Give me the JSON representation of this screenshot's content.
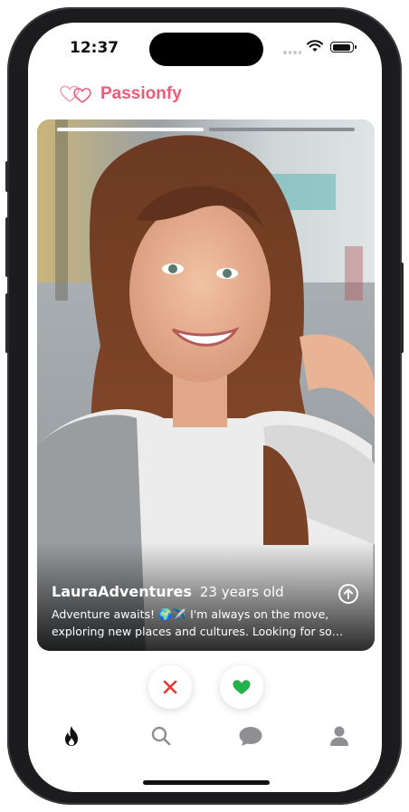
{
  "status_bar": {
    "time": "12:37"
  },
  "app": {
    "brand_name": "Passionfy",
    "brand_color": "#ef5a78"
  },
  "profile_card": {
    "photo_count": 2,
    "active_photo": 1,
    "username": "LauraAdventures",
    "age_label": "23 years old",
    "bio_line_1": "Adventure awaits! 🌍✈️ I'm always on the move,",
    "bio_line_2": "exploring new places and cultures. Looking for someo..."
  },
  "actions": {
    "dislike_icon": "close-icon",
    "dislike_color": "#e53935",
    "like_icon": "heart-icon",
    "like_color": "#22b14c"
  },
  "tab_bar": {
    "items": [
      {
        "icon": "flame-icon",
        "active": true
      },
      {
        "icon": "search-icon",
        "active": false
      },
      {
        "icon": "chat-icon",
        "active": false
      },
      {
        "icon": "profile-icon",
        "active": false
      }
    ],
    "active_color": "#111111",
    "inactive_color": "#8e8e93"
  }
}
